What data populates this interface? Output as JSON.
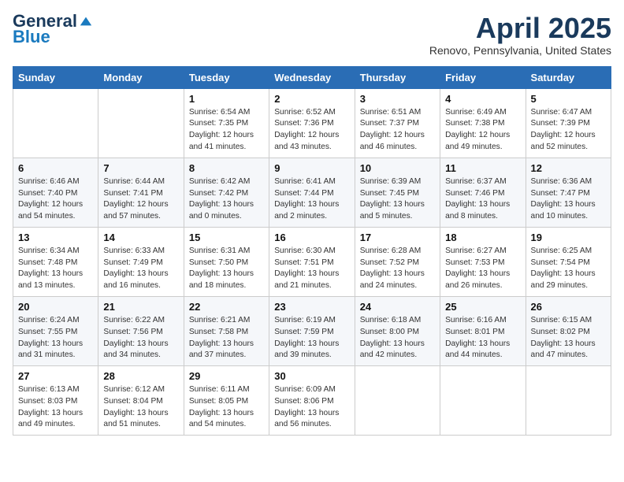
{
  "header": {
    "logo_general": "General",
    "logo_blue": "Blue",
    "month_title": "April 2025",
    "location": "Renovo, Pennsylvania, United States"
  },
  "weekdays": [
    "Sunday",
    "Monday",
    "Tuesday",
    "Wednesday",
    "Thursday",
    "Friday",
    "Saturday"
  ],
  "weeks": [
    [
      {
        "day": "",
        "info": ""
      },
      {
        "day": "",
        "info": ""
      },
      {
        "day": "1",
        "info": "Sunrise: 6:54 AM\nSunset: 7:35 PM\nDaylight: 12 hours and 41 minutes."
      },
      {
        "day": "2",
        "info": "Sunrise: 6:52 AM\nSunset: 7:36 PM\nDaylight: 12 hours and 43 minutes."
      },
      {
        "day": "3",
        "info": "Sunrise: 6:51 AM\nSunset: 7:37 PM\nDaylight: 12 hours and 46 minutes."
      },
      {
        "day": "4",
        "info": "Sunrise: 6:49 AM\nSunset: 7:38 PM\nDaylight: 12 hours and 49 minutes."
      },
      {
        "day": "5",
        "info": "Sunrise: 6:47 AM\nSunset: 7:39 PM\nDaylight: 12 hours and 52 minutes."
      }
    ],
    [
      {
        "day": "6",
        "info": "Sunrise: 6:46 AM\nSunset: 7:40 PM\nDaylight: 12 hours and 54 minutes."
      },
      {
        "day": "7",
        "info": "Sunrise: 6:44 AM\nSunset: 7:41 PM\nDaylight: 12 hours and 57 minutes."
      },
      {
        "day": "8",
        "info": "Sunrise: 6:42 AM\nSunset: 7:42 PM\nDaylight: 13 hours and 0 minutes."
      },
      {
        "day": "9",
        "info": "Sunrise: 6:41 AM\nSunset: 7:44 PM\nDaylight: 13 hours and 2 minutes."
      },
      {
        "day": "10",
        "info": "Sunrise: 6:39 AM\nSunset: 7:45 PM\nDaylight: 13 hours and 5 minutes."
      },
      {
        "day": "11",
        "info": "Sunrise: 6:37 AM\nSunset: 7:46 PM\nDaylight: 13 hours and 8 minutes."
      },
      {
        "day": "12",
        "info": "Sunrise: 6:36 AM\nSunset: 7:47 PM\nDaylight: 13 hours and 10 minutes."
      }
    ],
    [
      {
        "day": "13",
        "info": "Sunrise: 6:34 AM\nSunset: 7:48 PM\nDaylight: 13 hours and 13 minutes."
      },
      {
        "day": "14",
        "info": "Sunrise: 6:33 AM\nSunset: 7:49 PM\nDaylight: 13 hours and 16 minutes."
      },
      {
        "day": "15",
        "info": "Sunrise: 6:31 AM\nSunset: 7:50 PM\nDaylight: 13 hours and 18 minutes."
      },
      {
        "day": "16",
        "info": "Sunrise: 6:30 AM\nSunset: 7:51 PM\nDaylight: 13 hours and 21 minutes."
      },
      {
        "day": "17",
        "info": "Sunrise: 6:28 AM\nSunset: 7:52 PM\nDaylight: 13 hours and 24 minutes."
      },
      {
        "day": "18",
        "info": "Sunrise: 6:27 AM\nSunset: 7:53 PM\nDaylight: 13 hours and 26 minutes."
      },
      {
        "day": "19",
        "info": "Sunrise: 6:25 AM\nSunset: 7:54 PM\nDaylight: 13 hours and 29 minutes."
      }
    ],
    [
      {
        "day": "20",
        "info": "Sunrise: 6:24 AM\nSunset: 7:55 PM\nDaylight: 13 hours and 31 minutes."
      },
      {
        "day": "21",
        "info": "Sunrise: 6:22 AM\nSunset: 7:56 PM\nDaylight: 13 hours and 34 minutes."
      },
      {
        "day": "22",
        "info": "Sunrise: 6:21 AM\nSunset: 7:58 PM\nDaylight: 13 hours and 37 minutes."
      },
      {
        "day": "23",
        "info": "Sunrise: 6:19 AM\nSunset: 7:59 PM\nDaylight: 13 hours and 39 minutes."
      },
      {
        "day": "24",
        "info": "Sunrise: 6:18 AM\nSunset: 8:00 PM\nDaylight: 13 hours and 42 minutes."
      },
      {
        "day": "25",
        "info": "Sunrise: 6:16 AM\nSunset: 8:01 PM\nDaylight: 13 hours and 44 minutes."
      },
      {
        "day": "26",
        "info": "Sunrise: 6:15 AM\nSunset: 8:02 PM\nDaylight: 13 hours and 47 minutes."
      }
    ],
    [
      {
        "day": "27",
        "info": "Sunrise: 6:13 AM\nSunset: 8:03 PM\nDaylight: 13 hours and 49 minutes."
      },
      {
        "day": "28",
        "info": "Sunrise: 6:12 AM\nSunset: 8:04 PM\nDaylight: 13 hours and 51 minutes."
      },
      {
        "day": "29",
        "info": "Sunrise: 6:11 AM\nSunset: 8:05 PM\nDaylight: 13 hours and 54 minutes."
      },
      {
        "day": "30",
        "info": "Sunrise: 6:09 AM\nSunset: 8:06 PM\nDaylight: 13 hours and 56 minutes."
      },
      {
        "day": "",
        "info": ""
      },
      {
        "day": "",
        "info": ""
      },
      {
        "day": "",
        "info": ""
      }
    ]
  ]
}
